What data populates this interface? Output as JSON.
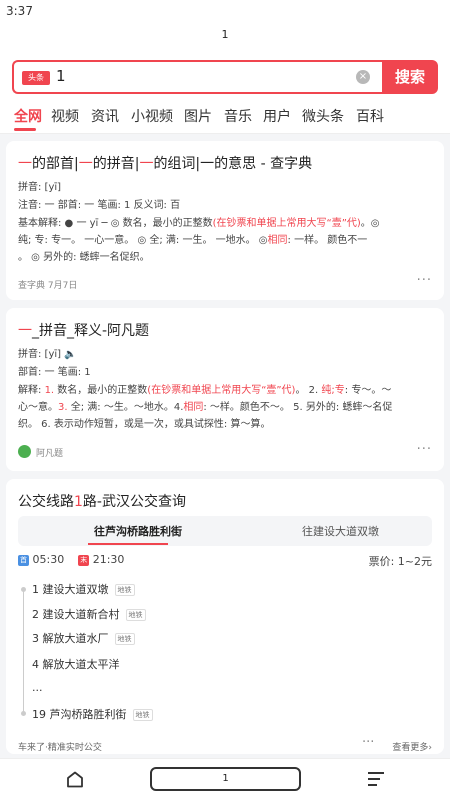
{
  "status": {
    "time": "3:37"
  },
  "page_indicator": "1",
  "search": {
    "logo": "头条",
    "query": "1",
    "button": "搜索"
  },
  "tabs": [
    "全网",
    "视频",
    "资讯",
    "小视频",
    "图片",
    "音乐",
    "用户",
    "微头条",
    "百科"
  ],
  "card1": {
    "title_parts": [
      "一",
      "的部首|",
      "一",
      "的拼音|",
      "一",
      "的组词|一的意思 - 查字典"
    ],
    "pinyin": "拼音: [yī]",
    "info": "注音: 一  部首: 一  笔画: 1  反义词: 百",
    "explain_a": "基本解释: ● 一 yī ─ ◎ 数名，最小的正整数",
    "explain_red": "(在钞票和单据上常用大写“壹”代)",
    "explain_b": "。◎",
    "explain_2a": "纯; 专: 专一。 一心一意。 ◎ 全; 满: 一生。 一地水。 ◎",
    "explain_2red": "相同",
    "explain_2b": ": 一样。 颜色不一",
    "explain_3": "。 ◎ 另外的: 蟋蟀一名促织。",
    "source": "查字典  7月7日",
    "more": "···"
  },
  "card2": {
    "title_red": "一",
    "title_rest": "_拼音_释义-阿凡题",
    "pinyin": "拼音: [yī]",
    "sound_icon": "speaker-icon",
    "info": "部首: 一  笔画: 1",
    "exp_a": "解释: ",
    "exp_n1": "1.",
    "exp_b": " 数名，最小的正整数",
    "exp_red": "(在钞票和单据上常用大写“壹”代)",
    "exp_c": "。 2.",
    "exp_d": " 纯;",
    "exp_red2": "专",
    "exp_e": ": 专～。～",
    "exp_2a": "心～意。",
    "exp_2n": "3.",
    "exp_2b": " 全; 满: ～生。～地水。",
    "exp_2n4": "4.",
    "exp_2red": "相同",
    "exp_2c": ": ～样。颜色不～。 5. 另外的: 蟋蟀～名促",
    "exp_3": "织。 6. 表示动作短暂，或是一次，或具试探性: 算～算。",
    "source": "阿凡题",
    "more": "···"
  },
  "card3": {
    "title_a": "公交线路",
    "title_red": "1",
    "title_b": "路-武汉公交查询",
    "subtab_active": "往芦沟桥路胜利街",
    "subtab_other": "往建设大道双墩",
    "first_label": "首",
    "first": "05:30",
    "last_label": "末",
    "last": "21:30",
    "fare": "票价: 1~2元",
    "stops": [
      {
        "name": "1 建设大道双墩",
        "tag": "地铁"
      },
      {
        "name": "2 建设大道新合村",
        "tag": "地铁"
      },
      {
        "name": "3 解放大道水厂",
        "tag": "地铁"
      },
      {
        "name": "4 解放大道太平洋",
        "tag": ""
      },
      {
        "name": "...",
        "tag": ""
      },
      {
        "name": "19 芦沟桥路胜利街",
        "tag": "地铁"
      }
    ],
    "footer_left": "车来了·精准实时公交",
    "footer_right": "查看更多",
    "more": "···"
  },
  "bottom": {
    "url": "1"
  }
}
